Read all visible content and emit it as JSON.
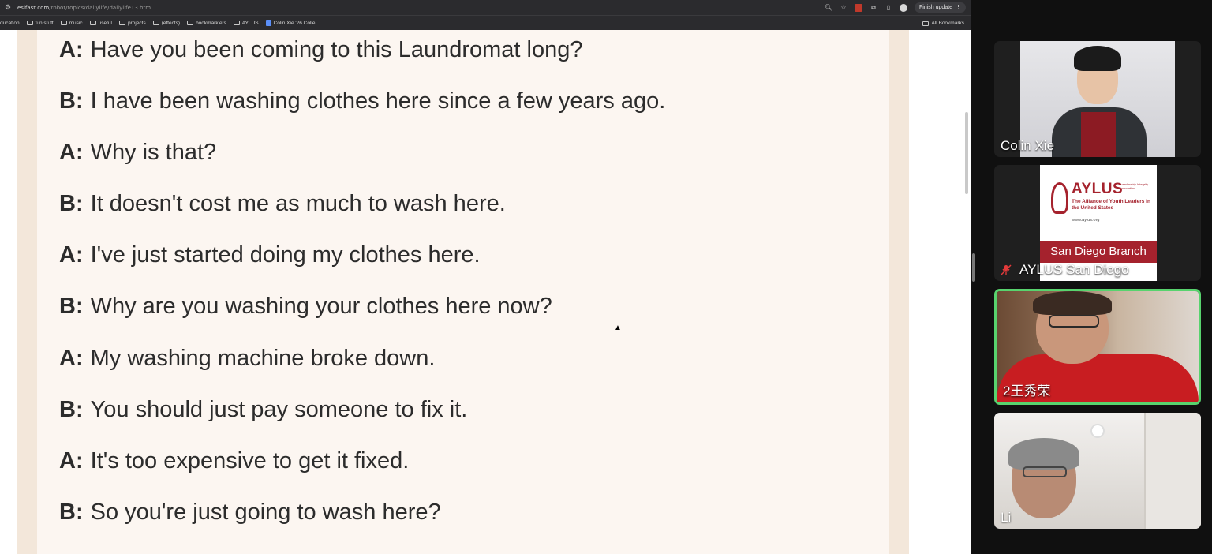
{
  "browser": {
    "url_host": "eslfast.com",
    "url_path": "/robot/topics/dailylife/dailylife13.htm",
    "update_button_label": "Finish update",
    "bookmarks": [
      {
        "label": "ducation",
        "icon": "folder-icon"
      },
      {
        "label": "fun stuff",
        "icon": "folder-icon"
      },
      {
        "label": "music",
        "icon": "folder-icon"
      },
      {
        "label": "useful",
        "icon": "folder-icon"
      },
      {
        "label": "projects",
        "icon": "folder-icon"
      },
      {
        "label": "(effects)",
        "icon": "folder-icon"
      },
      {
        "label": "bookmarklets",
        "icon": "folder-icon"
      },
      {
        "label": "AYLUS",
        "icon": "folder-icon"
      },
      {
        "label": "Colin Xie '26 Colle...",
        "icon": "doc-icon"
      }
    ],
    "all_bookmarks_label": "All Bookmarks"
  },
  "dialogue": [
    {
      "speaker": "A:",
      "text": "Have you been coming to this Laundromat long?"
    },
    {
      "speaker": "B:",
      "text": "I have been washing clothes here since a few years ago."
    },
    {
      "speaker": "A:",
      "text": "Why is that?"
    },
    {
      "speaker": "B:",
      "text": "It doesn't cost me as much to wash here."
    },
    {
      "speaker": "A:",
      "text": "I've just started doing my clothes here."
    },
    {
      "speaker": "B:",
      "text": "Why are you washing your clothes here now?"
    },
    {
      "speaker": "A:",
      "text": "My washing machine broke down."
    },
    {
      "speaker": "B:",
      "text": "You should just pay someone to fix it."
    },
    {
      "speaker": "A:",
      "text": "It's too expensive to get it fixed."
    },
    {
      "speaker": "B:",
      "text": "So you're just going to wash here?"
    }
  ],
  "participants": [
    {
      "name": "Colin Xie",
      "muted": false,
      "speaking": false
    },
    {
      "name": "AYLUS San Diego",
      "muted": true,
      "speaking": false
    },
    {
      "name": "2王秀荣",
      "muted": false,
      "speaking": true
    },
    {
      "name": "Li",
      "muted": false,
      "speaking": false
    }
  ],
  "aylus_logo": {
    "wordmark": "AYLUS",
    "tagline": "Leadership Integrity Innovation",
    "subtitle": "The Alliance of Youth Leaders in the United States",
    "url": "www.aylus.org",
    "branch": "San Diego Branch"
  },
  "colors": {
    "speaking_border": "#58d36e",
    "aylus_red": "#a5222d",
    "page_background": "#fcf6f1"
  }
}
